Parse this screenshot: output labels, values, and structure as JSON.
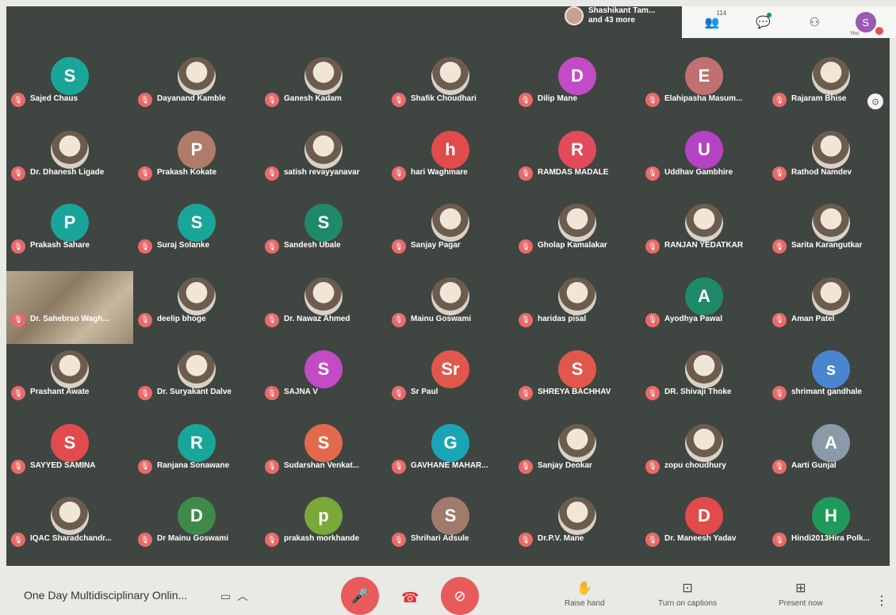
{
  "top": {
    "participants_summary_line1": "Shashikant Tam...",
    "participants_summary_line2": "and 43 more",
    "people_count": "114",
    "you_label": "You",
    "self_initial": "S"
  },
  "icons": {
    "people": "people-icon",
    "chat": "chat-icon",
    "activities": "activities-icon",
    "mic_off": "mic-off-icon",
    "pin": "pin-icon",
    "hangup": "hangup-icon",
    "camera_off": "camera-off-icon",
    "raise_hand": "hand-icon",
    "captions": "captions-icon",
    "present": "present-icon",
    "more": "more-vert-icon"
  },
  "participants": [
    {
      "name": "Sajed Chaus",
      "initial": "S",
      "color": "#1aa59a"
    },
    {
      "name": "Dayanand Kamble",
      "initial": "",
      "color": "#6b5c4e"
    },
    {
      "name": "Ganesh Kadam",
      "initial": "",
      "color": "#6b5c4e"
    },
    {
      "name": "Shafik Choudhari",
      "initial": "",
      "color": "#6b5c4e"
    },
    {
      "name": "Dilip Mane",
      "initial": "D",
      "color": "#c44bc6"
    },
    {
      "name": "Elahipasha Masum...",
      "initial": "E",
      "color": "#c07070"
    },
    {
      "name": "Rajaram Bhise",
      "initial": "",
      "color": "#6b5c4e"
    },
    {
      "name": "Dr. Dhanesh Ligade",
      "initial": "",
      "color": "#6b5c4e"
    },
    {
      "name": "Prakash Kokate",
      "initial": "P",
      "color": "#b07c6a"
    },
    {
      "name": "satish revayyanavar",
      "initial": "",
      "color": "#6b5c4e"
    },
    {
      "name": "hari Waghmare",
      "initial": "h",
      "color": "#e24b4b"
    },
    {
      "name": "RAMDAS MADALE",
      "initial": "R",
      "color": "#e24b5b"
    },
    {
      "name": "Uddhav Gambhire",
      "initial": "U",
      "color": "#b443c4"
    },
    {
      "name": "Rathod Namdev",
      "initial": "",
      "color": "#6b5c4e"
    },
    {
      "name": "Prakash Sahare",
      "initial": "P",
      "color": "#1aa59a"
    },
    {
      "name": "Suraj Solanke",
      "initial": "S",
      "color": "#1aa59a"
    },
    {
      "name": "Sandesh Ubale",
      "initial": "S",
      "color": "#1f8a6a"
    },
    {
      "name": "Sanjay Pagar",
      "initial": "",
      "color": "#6b5c4e"
    },
    {
      "name": "Gholap Kamalakar",
      "initial": "",
      "color": "#6b5c4e"
    },
    {
      "name": "RANJAN YEDATKAR",
      "initial": "",
      "color": "#6b5c4e"
    },
    {
      "name": "Sarita Karangutkar",
      "initial": "",
      "color": "#6b5c4e"
    },
    {
      "name": "Dr. Sahebrao Wagh...",
      "initial": "",
      "color": "#6b5c4e",
      "video": true
    },
    {
      "name": "deelip bhoge",
      "initial": "",
      "color": "#6b5c4e"
    },
    {
      "name": "Dr. Nawaz Ahmed",
      "initial": "",
      "color": "#6b5c4e"
    },
    {
      "name": "Mainu Goswami",
      "initial": "",
      "color": "#6b5c4e"
    },
    {
      "name": "haridas pisal",
      "initial": "",
      "color": "#6b5c4e"
    },
    {
      "name": "Ayodhya Pawal",
      "initial": "A",
      "color": "#1f8a6a"
    },
    {
      "name": "Aman Patel",
      "initial": "",
      "color": "#6b5c4e"
    },
    {
      "name": "Prashant Awate",
      "initial": "",
      "color": "#6b5c4e"
    },
    {
      "name": "Dr. Suryakant Dalve",
      "initial": "",
      "color": "#6b5c4e"
    },
    {
      "name": "SAJNA V",
      "initial": "S",
      "color": "#c44bc6"
    },
    {
      "name": "Sr Paul",
      "initial": "Sr",
      "color": "#e2574b"
    },
    {
      "name": "SHREYA BACHHAV",
      "initial": "S",
      "color": "#e2574b"
    },
    {
      "name": "DR. Shivaji Thoke",
      "initial": "",
      "color": "#6b5c4e"
    },
    {
      "name": "shrimant gandhale",
      "initial": "s",
      "color": "#4a86d0"
    },
    {
      "name": "SAYYED SAMINA",
      "initial": "S",
      "color": "#e24b4b"
    },
    {
      "name": "Ranjana Sonawane",
      "initial": "R",
      "color": "#1aa59a"
    },
    {
      "name": "Sudarshan Venkat...",
      "initial": "S",
      "color": "#e2694b"
    },
    {
      "name": "GAVHANE MAHAR...",
      "initial": "G",
      "color": "#1aa5b5"
    },
    {
      "name": "Sanjay Deokar",
      "initial": "",
      "color": "#6b5c4e"
    },
    {
      "name": "zopu choudhury",
      "initial": "",
      "color": "#6b5c4e"
    },
    {
      "name": "Aarti Gunjal",
      "initial": "A",
      "color": "#8a9aa8"
    },
    {
      "name": "IQAC Sharadchandr...",
      "initial": "",
      "color": "#6b5c4e"
    },
    {
      "name": "Dr Mainu Goswami",
      "initial": "D",
      "color": "#3f8a4a"
    },
    {
      "name": "prakash morkhande",
      "initial": "p",
      "color": "#7aa83a"
    },
    {
      "name": "Shrihari Adsule",
      "initial": "S",
      "color": "#a07a6a"
    },
    {
      "name": "Dr.P.V. Mane",
      "initial": "",
      "color": "#6b5c4e"
    },
    {
      "name": "Dr. Maneesh Yadav",
      "initial": "D",
      "color": "#e24b4b"
    },
    {
      "name": "Hindi2013Hira Polk...",
      "initial": "H",
      "color": "#1f9a5a"
    }
  ],
  "bottom": {
    "meeting_title": "One Day Multidisciplinary Onlin...",
    "raise_hand_label": "Raise hand",
    "captions_label": "Turn on captions",
    "present_label": "Present now"
  }
}
